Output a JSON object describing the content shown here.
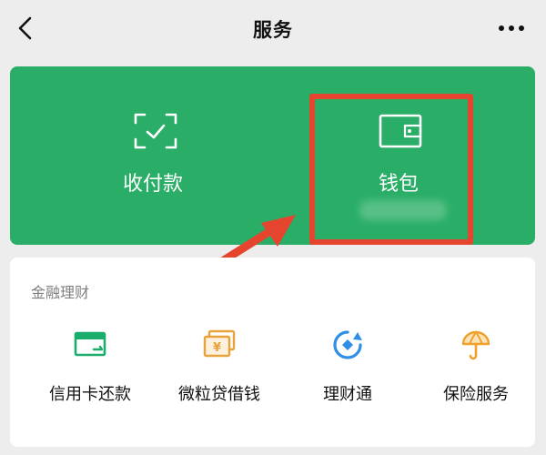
{
  "header": {
    "title": "服务",
    "back_icon": "chevron-left-icon",
    "more_icon": "more-dots-icon"
  },
  "wallet_card": {
    "background_color": "#2aae67",
    "tiles": [
      {
        "label": "收付款",
        "icon": "scan-check-icon"
      },
      {
        "label": "钱包",
        "icon": "wallet-icon"
      }
    ]
  },
  "annotation": {
    "highlight_color": "#e5452f",
    "arrow_icon": "red-arrow"
  },
  "finance": {
    "section_title": "金融理财",
    "items": [
      {
        "label": "信用卡还款",
        "icon": "credit-card-icon",
        "color": "#1aad6b"
      },
      {
        "label": "微粒贷借钱",
        "icon": "loan-money-icon",
        "color": "#e8a23b"
      },
      {
        "label": "理财通",
        "icon": "wealth-icon",
        "color": "#2f8fe6"
      },
      {
        "label": "保险服务",
        "icon": "insurance-umbrella-icon",
        "color": "#f0a02c"
      }
    ]
  }
}
